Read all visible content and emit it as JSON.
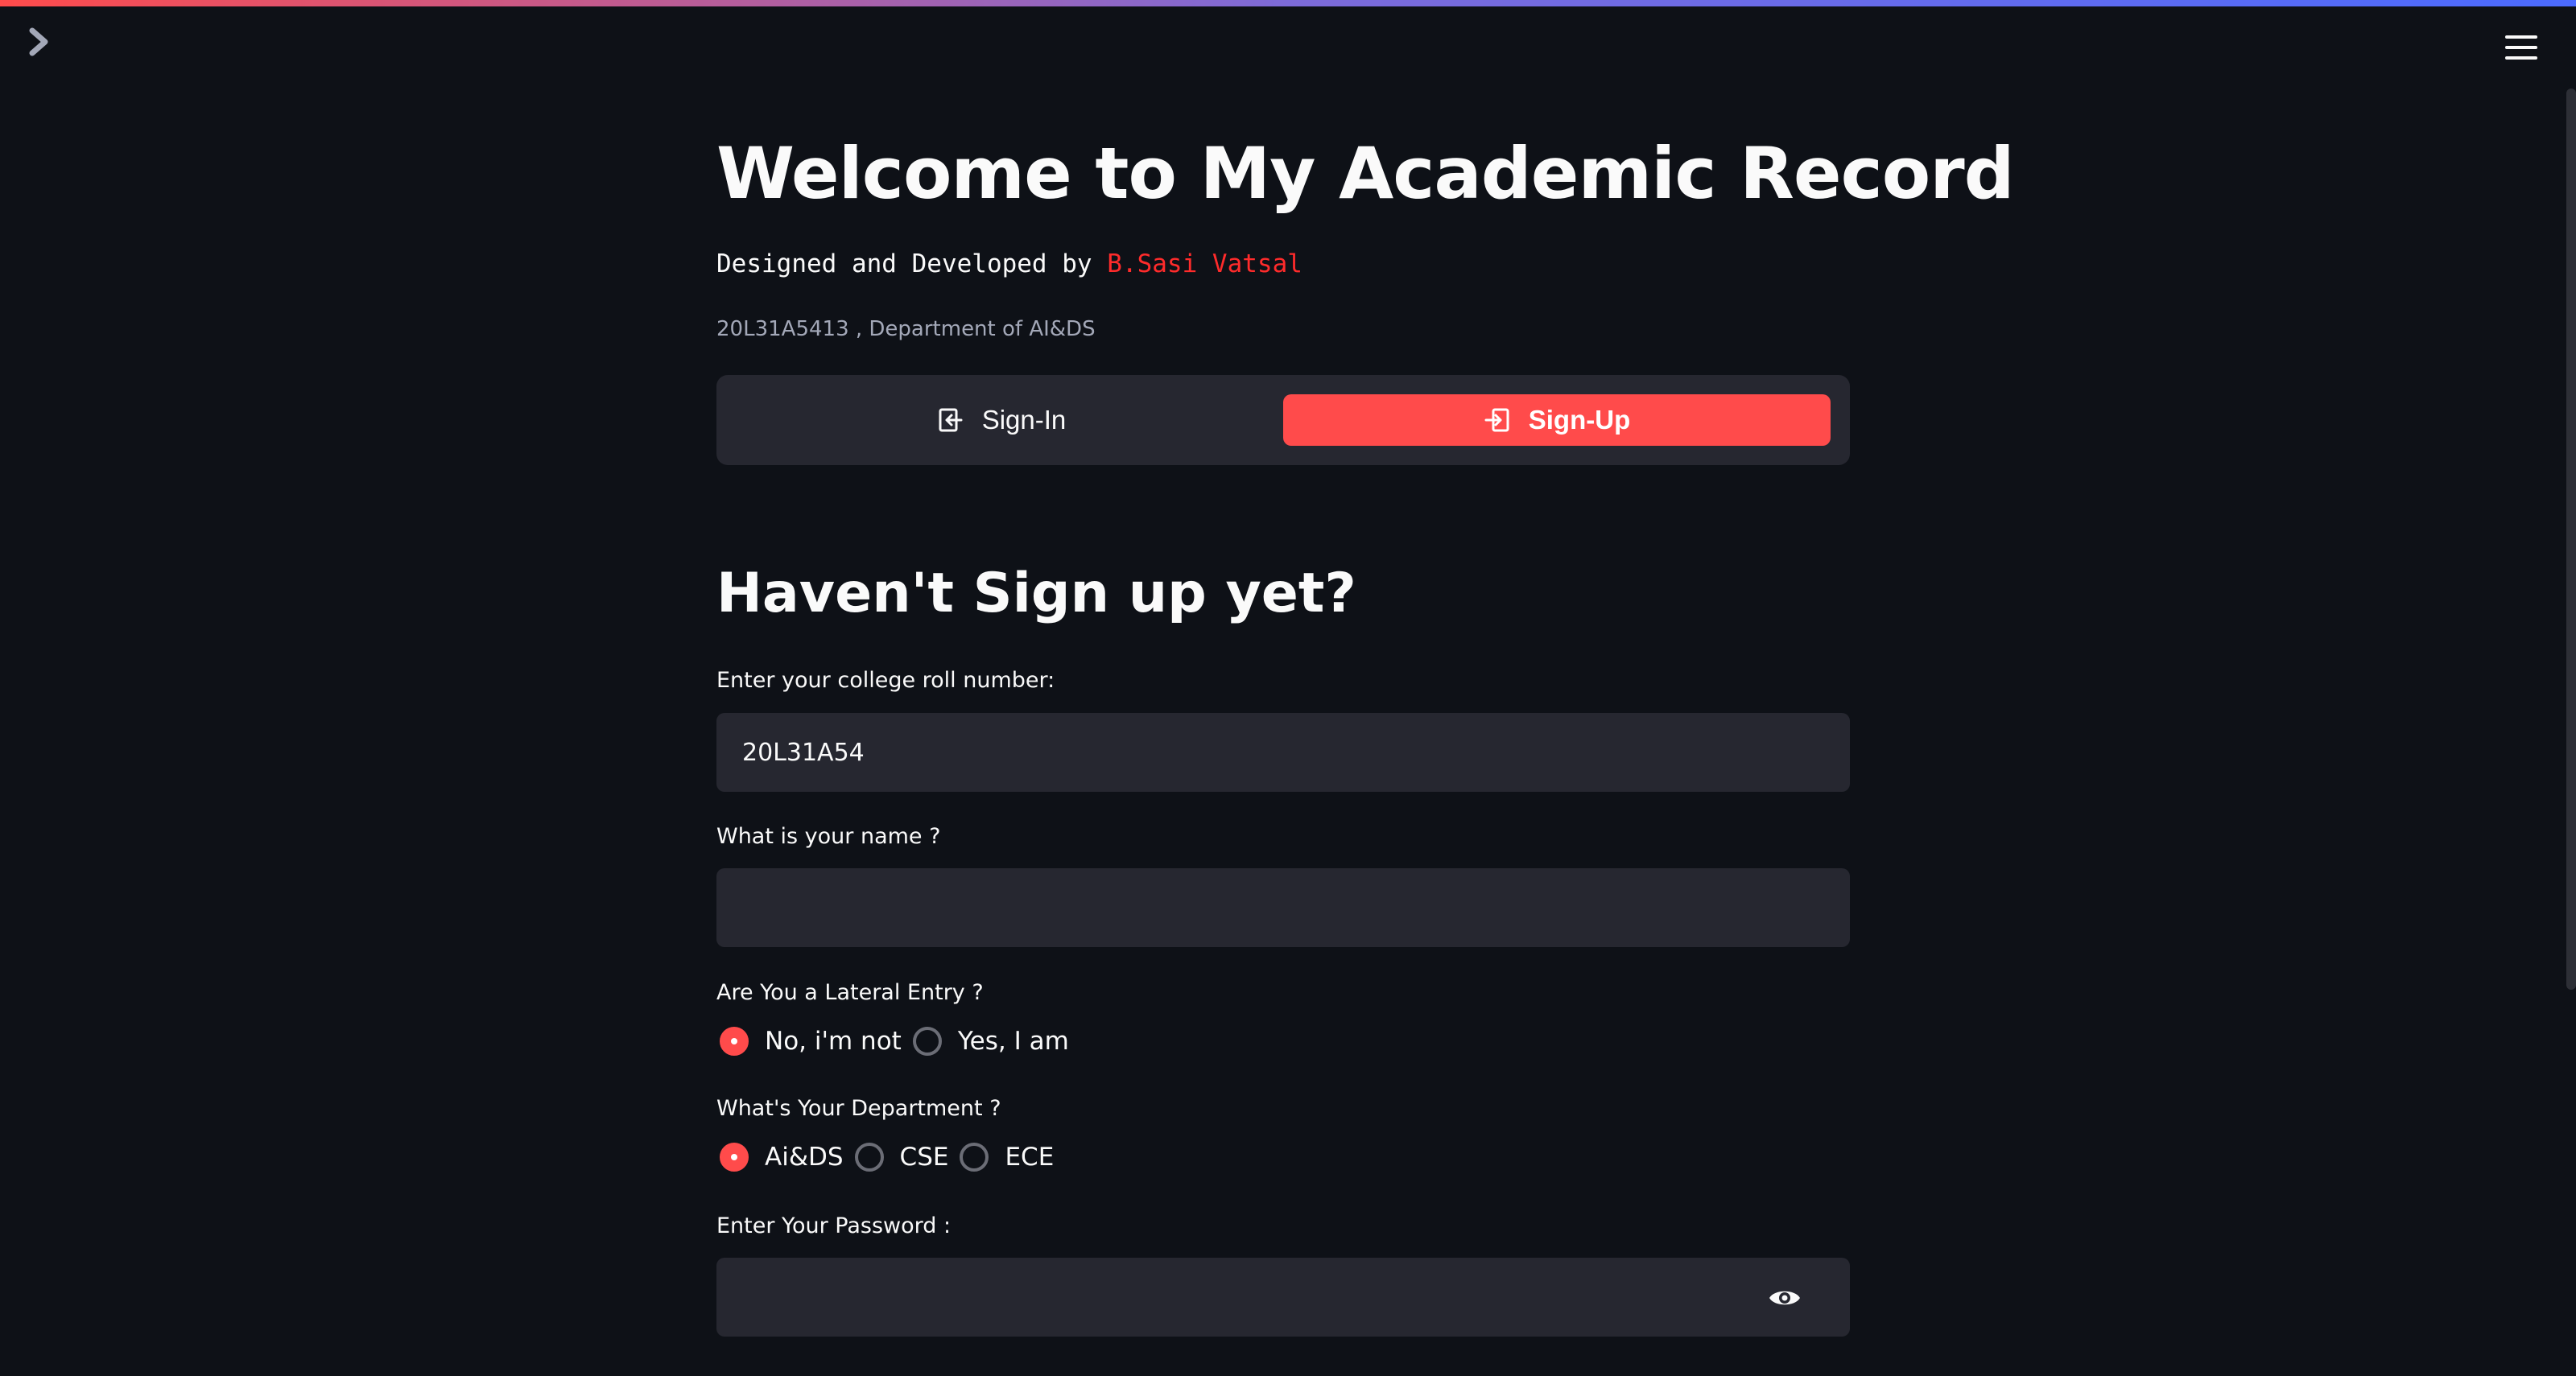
{
  "app": {
    "title": "Welcome to My Academic Record",
    "byline_prefix": "Designed and Developed by ",
    "author": "B.Sasi Vatsal",
    "caption": "20L31A5413 , Department of AI&DS"
  },
  "tabs": [
    {
      "label": "Sign-In",
      "icon": "sign-in-icon",
      "active": false
    },
    {
      "label": "Sign-Up",
      "icon": "sign-up-icon",
      "active": true
    }
  ],
  "form": {
    "heading": "Haven't Sign up yet?",
    "roll": {
      "label": "Enter your college roll number:",
      "value": "20L31A54"
    },
    "name": {
      "label": "What is your name ?",
      "value": ""
    },
    "lateral": {
      "label": "Are You a Lateral Entry ?",
      "options": [
        "No, i'm not",
        "Yes, I am"
      ],
      "selected": "No, i'm not"
    },
    "department": {
      "label": "What's Your Department ?",
      "options": [
        "Ai&DS",
        "CSE",
        "ECE"
      ],
      "selected": "Ai&DS"
    },
    "password": {
      "label": "Enter Your Password :",
      "value": ""
    }
  },
  "colors": {
    "accent": "#ff4b4b",
    "background": "#0e1117",
    "panel": "#262730",
    "author": "#ff2b2b"
  }
}
